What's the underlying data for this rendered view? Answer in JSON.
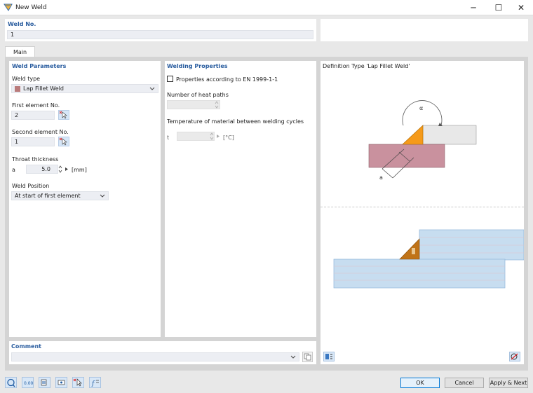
{
  "window": {
    "title": "New Weld",
    "minimize": "─",
    "maximize": "☐",
    "close": "✕"
  },
  "weld_no": {
    "label": "Weld No.",
    "value": "1"
  },
  "tabs": [
    {
      "label": "Main"
    }
  ],
  "weld_parameters": {
    "header": "Weld Parameters",
    "weld_type_label": "Weld type",
    "weld_type_value": "Lap Fillet Weld",
    "weld_type_color": "#b97a7a",
    "first_element_label": "First element No.",
    "first_element_value": "2",
    "second_element_label": "Second element No.",
    "second_element_value": "1",
    "throat_label": "Throat thickness",
    "throat_symbol": "a",
    "throat_value": "5.0",
    "throat_unit": "[mm]",
    "position_label": "Weld Position",
    "position_value": "At start of first element"
  },
  "welding_properties": {
    "header": "Welding Properties",
    "en_checkbox_label": "Properties according to EN 1999-1-1",
    "en_checked": false,
    "heat_paths_label": "Number of heat paths",
    "heat_paths_value": "",
    "temperature_label": "Temperature of material between welding cycles",
    "temperature_symbol": "t",
    "temperature_value": "",
    "temperature_unit": "[°C]"
  },
  "definition": {
    "header": "Definition Type 'Lap Fillet Weld'",
    "alpha_label": "α",
    "a_label": "a"
  },
  "comment": {
    "label": "Comment",
    "value": ""
  },
  "buttons": {
    "ok": "OK",
    "cancel": "Cancel",
    "apply_next": "Apply & Next"
  }
}
